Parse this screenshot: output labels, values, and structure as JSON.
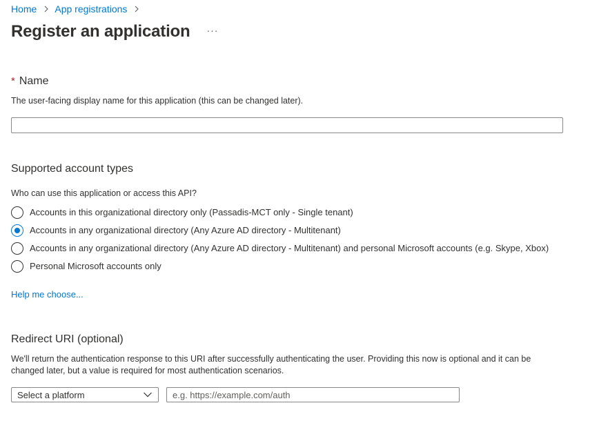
{
  "breadcrumb": {
    "items": [
      {
        "label": "Home"
      },
      {
        "label": "App registrations"
      }
    ]
  },
  "header": {
    "title": "Register an application",
    "more_label": "···"
  },
  "name_section": {
    "required_marker": "*",
    "label": "Name",
    "help": "The user-facing display name for this application (this can be changed later).",
    "value": ""
  },
  "account_types": {
    "heading": "Supported account types",
    "question": "Who can use this application or access this API?",
    "options": [
      {
        "label": "Accounts in this organizational directory only (Passadis-MCT only - Single tenant)",
        "checked": false
      },
      {
        "label": "Accounts in any organizational directory (Any Azure AD directory - Multitenant)",
        "checked": true
      },
      {
        "label": "Accounts in any organizational directory (Any Azure AD directory - Multitenant) and personal Microsoft accounts (e.g. Skype, Xbox)",
        "checked": false
      },
      {
        "label": "Personal Microsoft accounts only",
        "checked": false
      }
    ],
    "help_link": "Help me choose..."
  },
  "redirect": {
    "heading": "Redirect URI (optional)",
    "description_line1": "We'll return the authentication response to this URI after successfully authenticating the user. Providing this now is optional and it can be",
    "description_line2": "changed later, but a value is required for most authentication scenarios.",
    "platform_select": "Select a platform",
    "uri_placeholder": "e.g. https://example.com/auth",
    "uri_value": ""
  },
  "colors": {
    "accent": "#0078d4",
    "required": "#a4262c",
    "text": "#323130",
    "border": "#8a8886"
  },
  "icons": {
    "breadcrumb_separator": "chevron-right-icon",
    "select_chevron": "chevron-down-icon",
    "more": "ellipsis-icon"
  }
}
